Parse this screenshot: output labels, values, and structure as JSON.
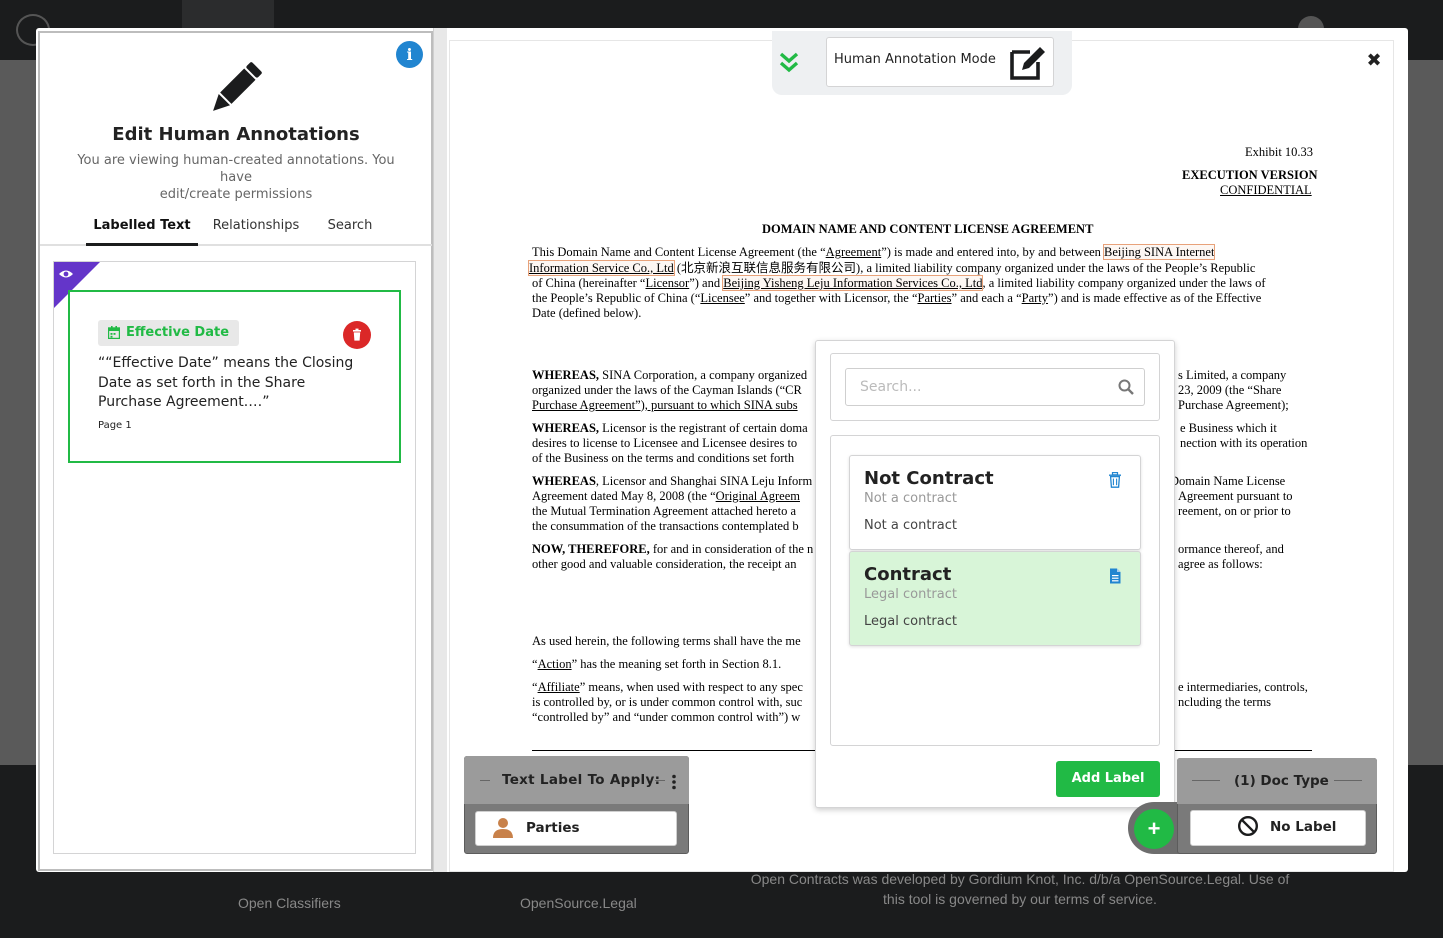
{
  "background": {
    "footer": {
      "link1": "Open Classifiers",
      "link2": "OpenSource.Legal",
      "notice_line1": "Open Contracts was developed by Gordium Knot, Inc. d/b/a OpenSource.Legal. Use of",
      "notice_line2": "this tool is governed by our terms of service."
    }
  },
  "left_panel": {
    "info_icon": "info-circle-icon",
    "title": "Edit Human Annotations",
    "subtitle_line1": "You are viewing human-created annotations. You have",
    "subtitle_line2": "edit/create permissions",
    "tabs": [
      "Labelled Text",
      "Relationships",
      "Search"
    ],
    "active_tab": "Labelled Text",
    "annotation": {
      "label": "Effective Date",
      "text": "““Effective Date” means the Closing Date as set forth in the Share Purchase Agreement.…”",
      "page": "Page 1",
      "accent_color": "#21ba45"
    }
  },
  "mode_bar": {
    "label": "Human Annotation Mode"
  },
  "document": {
    "exhibit": "Exhibit 10.33",
    "execution_version": "EXECUTION VERSION",
    "confidential": "CONFIDENTIAL",
    "heading": "DOMAIN NAME AND CONTENT LICENSE AGREEMENT",
    "p1": [
      [
        "This Domain Name and Content License Agreement (the “",
        "Agreement",
        "”) is made and entered into, by and between ",
        "Beijing SINA Internet"
      ],
      [
        "Information Service Co., Ltd",
        " (北京新浪互联信息服务有限公司), a limited liability company organized under the laws of the People’s Republic"
      ],
      [
        "of China (hereinafter “",
        "Licensor",
        "”) and ",
        "Beijing Yisheng Leju Information Services Co., Ltd",
        ", a limited liability company organized under the laws of"
      ],
      [
        "the People’s Republic of China (“",
        "Licensee",
        "” and together with Licensor, the “",
        "Parties",
        "” and each a “",
        "Party",
        "”) and is made effective as of the Effective"
      ],
      [
        "Date (defined below)."
      ]
    ],
    "whereas1_left": [
      "WHEREAS,",
      " SINA Corporation, a company organized",
      "organized under the laws of the Cayman Islands (“CR",
      "Purchase Agreement”), pursuant to which SINA subs"
    ],
    "whereas1_right": [
      "s Limited, a company",
      "23, 2009 (the “Share",
      "Purchase Agreement);"
    ],
    "whereas2_left": [
      "WHEREAS,",
      " Licensor is the registrant of certain doma",
      "desires to license to Licensee and Licensee desires to",
      "of the Business on the terms and conditions set forth"
    ],
    "whereas2_right": [
      "e Business which it",
      "nection with its operation"
    ],
    "whereas3_left": [
      "WHEREAS",
      ", Licensor and Shanghai SINA Leju Inform",
      "Agreement dated May 8, 2008 (the “",
      "Original Agreem",
      "the Mutual Termination Agreement attached hereto a",
      "the consummation of the transactions contemplated b"
    ],
    "whereas3_right": [
      "Domain Name License",
      "Agreement pursuant to",
      "reement, on or prior to"
    ],
    "now_left": [
      "NOW, THEREFORE,",
      " for and in consideration of the n",
      "other good and valuable consideration, the receipt an"
    ],
    "now_right": [
      "ormance thereof, and",
      "agree as follows:"
    ],
    "used_herein": "As used herein, the following terms shall have the me",
    "action": [
      "“",
      "Action",
      "” has the meaning set forth in Section 8.1."
    ],
    "affiliate_left": [
      "“",
      "Affiliate",
      "” means, when used with respect to any spec",
      "is controlled by, or is under common control with, suc",
      "“controlled by” and “under common control with”) w"
    ],
    "affiliate_right": [
      "e intermediaries, controls,",
      "ncluding the terms"
    ]
  },
  "label_popup": {
    "search_placeholder": "Search...",
    "labels": [
      {
        "title": "Not Contract",
        "meta": "Not a contract",
        "description": "Not a contract",
        "icon": "trash-icon"
      },
      {
        "title": "Contract",
        "meta": "Legal contract",
        "description": "Legal contract",
        "icon": "file-icon",
        "selected": true
      }
    ],
    "add_button": "Add Label"
  },
  "text_label_box": {
    "title": "Text Label To Apply:",
    "selected": "Parties",
    "icon": "user-icon"
  },
  "doc_type_box": {
    "title": "(1) Doc Type",
    "selected": "No Label",
    "icon": "ban-icon"
  },
  "colors": {
    "primary_green": "#21ba45",
    "danger_red": "#db2828",
    "info_blue": "#2185d0",
    "visibility_purple": "#6435c9"
  }
}
